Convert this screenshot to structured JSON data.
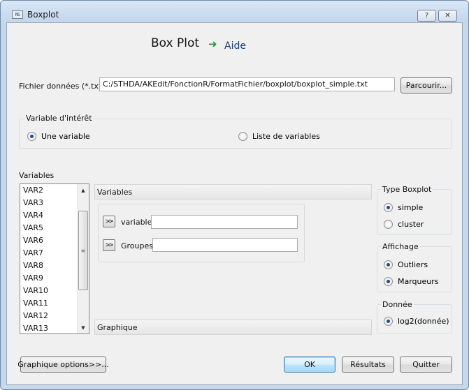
{
  "window": {
    "title": "Boxplot",
    "icon_text": "NS",
    "help_button": "?",
    "close_button": "✕"
  },
  "header": {
    "title": "Box Plot",
    "help_link": "Aide"
  },
  "file": {
    "label": "Fichier données (*.txt)",
    "value": "C:/STHDA/AKEdit/FonctionR/FormatFichier/boxplot/boxplot_simple.txt",
    "browse_label": "Parcourir..."
  },
  "variable_interest": {
    "title": "Variable d'intérêt",
    "options": [
      {
        "label": "Une variable",
        "selected": true
      },
      {
        "label": "Liste de variables",
        "selected": false
      }
    ]
  },
  "variables_list": {
    "label": "Variables",
    "items": [
      "VAR2",
      "VAR3",
      "VAR4",
      "VAR5",
      "VAR6",
      "VAR7",
      "VAR8",
      "VAR9",
      "VAR10",
      "VAR11",
      "VAR12",
      "VAR13"
    ]
  },
  "variables_panel": {
    "header": "Variables",
    "move_button": ">>",
    "variable_label": "variable",
    "variable_value": "",
    "groups_label": "Groupes",
    "groups_value": ""
  },
  "graphique_header": "Graphique",
  "type_boxplot": {
    "title": "Type Boxplot",
    "options": [
      {
        "label": "simple",
        "selected": true
      },
      {
        "label": "cluster",
        "selected": false
      }
    ]
  },
  "affichage": {
    "title": "Affichage",
    "options": [
      {
        "label": "Outliers",
        "selected": true
      },
      {
        "label": "Marqueurs",
        "selected": true
      }
    ]
  },
  "donnee": {
    "title": "Donnée",
    "options": [
      {
        "label": "log2(donnée)",
        "selected": true
      }
    ]
  },
  "footer": {
    "graph_options": "Graphique options>>...",
    "ok": "OK",
    "results": "Résultats",
    "quit": "Quitter"
  },
  "colors": {
    "titlebar": "#c7d8ea",
    "client_bg": "#f0f0f0",
    "help_arrow": "#1f9b33",
    "radio_dot": "#1b4f93"
  }
}
